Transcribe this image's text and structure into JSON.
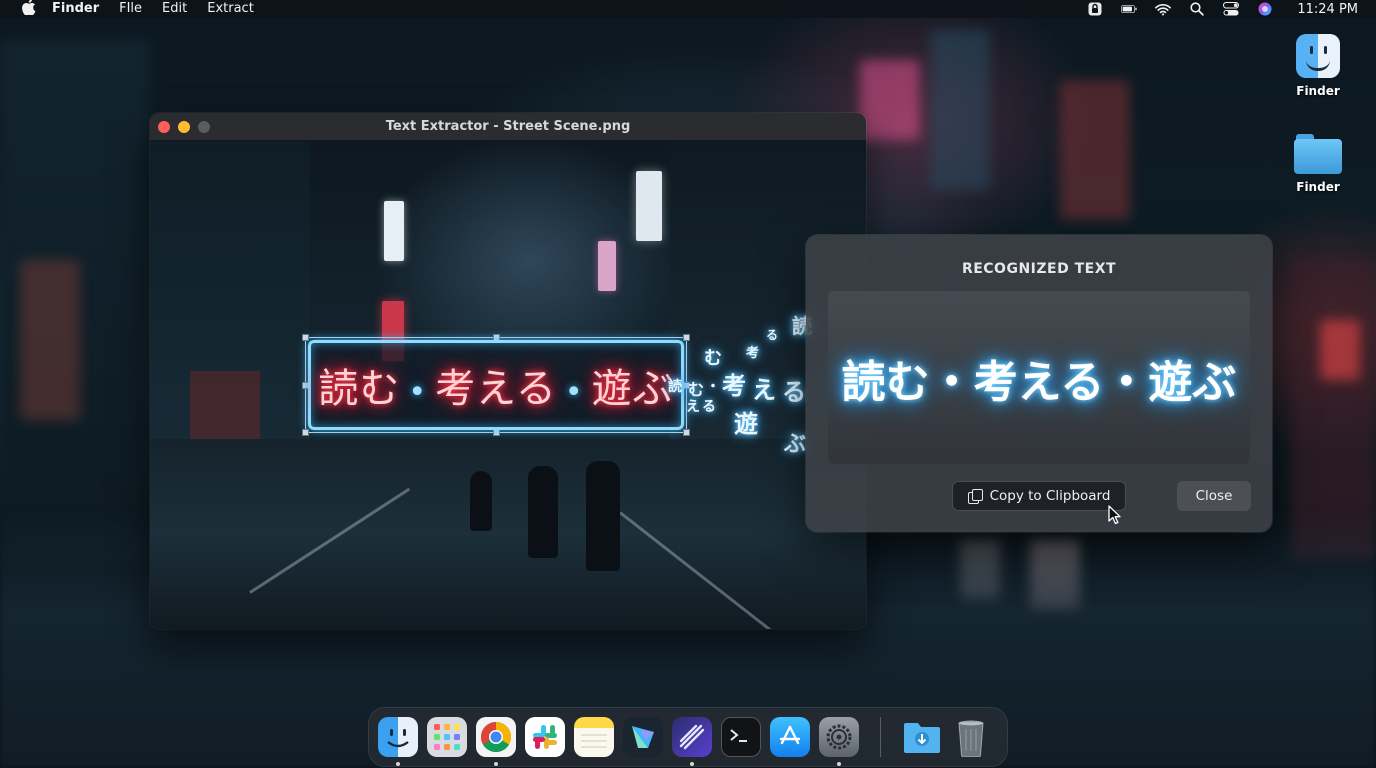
{
  "menubar": {
    "app_name": "Finder",
    "menus": [
      "FIle",
      "Edit",
      "Extract"
    ],
    "clock": "11:24 PM",
    "status_icons": [
      "screen-lock-icon",
      "battery-icon",
      "wifi-icon",
      "spotlight-search-icon",
      "control-center-icon",
      "siri-icon"
    ]
  },
  "desktop": {
    "icons": [
      {
        "label": "Finder",
        "icon": "finder-icon"
      },
      {
        "label": "Finder",
        "icon": "folder-icon"
      }
    ]
  },
  "window": {
    "title": "Text Extractor - Street Scene.png",
    "selected_text": "読む・考える・遊ぶ",
    "selected_parts": [
      "読む",
      "考える",
      "遊ぶ"
    ],
    "separator": "•",
    "flying_glyphs": [
      "読",
      "む",
      "・",
      "考",
      "え",
      "る",
      "遊",
      "ぶ"
    ]
  },
  "panel": {
    "title": "RECOGNIZED TEXT",
    "result": "読む・考える・遊ぶ",
    "copy_button": "Copy to Clipboard",
    "close_button": "Close"
  },
  "dock": {
    "apps": [
      {
        "name": "Finder",
        "icon": "finder-icon",
        "running": true
      },
      {
        "name": "Launchpad",
        "icon": "launchpad-icon",
        "running": false
      },
      {
        "name": "Chrome",
        "icon": "chrome-icon",
        "running": true
      },
      {
        "name": "Slack",
        "icon": "slack-icon",
        "running": false
      },
      {
        "name": "Notes",
        "icon": "notes-icon",
        "running": false
      },
      {
        "name": "Text Extractor",
        "icon": "text-extractor-icon",
        "running": false
      },
      {
        "name": "Linear",
        "icon": "linear-icon",
        "running": true
      },
      {
        "name": "Terminal",
        "icon": "terminal-icon",
        "running": false
      },
      {
        "name": "App Store",
        "icon": "app-store-icon",
        "running": false
      },
      {
        "name": "System Settings",
        "icon": "settings-icon",
        "running": true
      }
    ],
    "extras": [
      {
        "name": "Downloads",
        "icon": "downloads-folder-icon"
      },
      {
        "name": "Trash",
        "icon": "trash-icon"
      }
    ]
  },
  "colors": {
    "neon_red": "#ff1f3b",
    "neon_blue": "#34b2ff",
    "panel_bg": "#3e4248"
  }
}
